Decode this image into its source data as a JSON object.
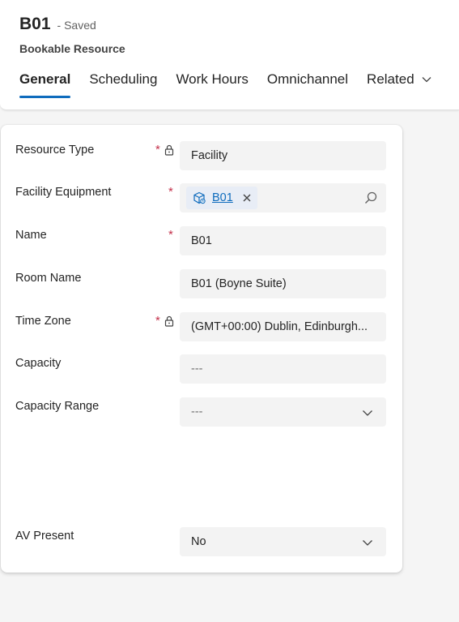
{
  "header": {
    "record_title": "B01",
    "saved_status": "- Saved",
    "entity_name": "Bookable Resource",
    "tabs": [
      {
        "label": "General",
        "active": true
      },
      {
        "label": "Scheduling",
        "active": false
      },
      {
        "label": "Work Hours",
        "active": false
      },
      {
        "label": "Omnichannel",
        "active": false
      },
      {
        "label": "Related",
        "active": false
      }
    ]
  },
  "form": {
    "resource_type": {
      "label": "Resource Type",
      "required_mark": "*",
      "value": "Facility"
    },
    "facility_equipment": {
      "label": "Facility Equipment",
      "required_mark": "*",
      "tag": "B01"
    },
    "name": {
      "label": "Name",
      "required_mark": "*",
      "value": "B01"
    },
    "room_name": {
      "label": "Room Name",
      "value": "B01 (Boyne Suite)"
    },
    "time_zone": {
      "label": "Time Zone",
      "required_mark": "*",
      "value": "(GMT+00:00) Dublin, Edinburgh..."
    },
    "capacity": {
      "label": "Capacity",
      "placeholder": "---"
    },
    "capacity_range": {
      "label": "Capacity Range",
      "placeholder": "---"
    },
    "av_present": {
      "label": "AV Present",
      "value": "No"
    }
  },
  "colors": {
    "accent": "#0f6cbd",
    "required": "#c4314b",
    "field_bg": "#f3f3f3",
    "page_bg": "#f5f5f5"
  }
}
